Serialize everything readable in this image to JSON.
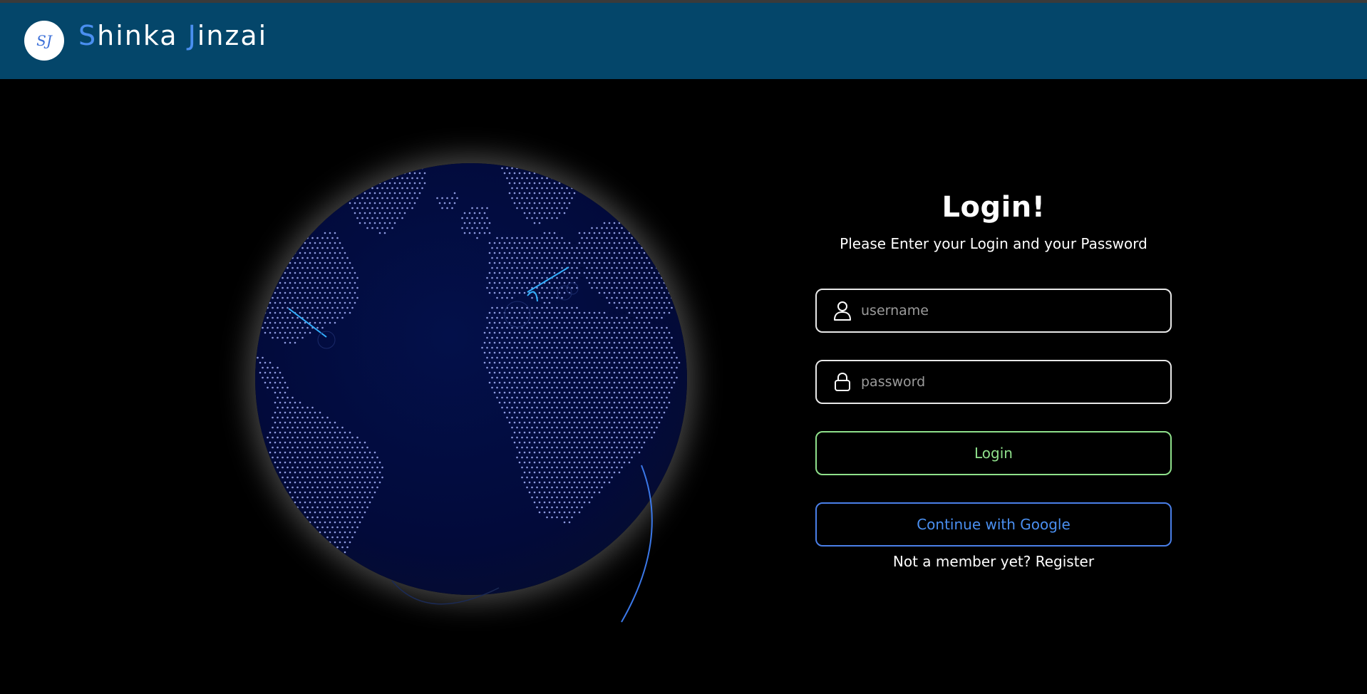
{
  "header": {
    "brand_first_initial": "S",
    "brand_first_rest": "hinka ",
    "brand_second_initial": "J",
    "brand_second_rest": "inzai",
    "logo_text": "SJ",
    "accent_color": "#4a8ff0",
    "background_color": "#04466a"
  },
  "login": {
    "title": "Login!",
    "subtitle": "Please Enter your Login and your Password",
    "username": {
      "icon": "user-icon",
      "value": "",
      "placeholder": "username"
    },
    "password": {
      "icon": "lock-icon",
      "value": "",
      "placeholder": "password"
    },
    "login_button": "Login",
    "google_button": "Continue with Google",
    "register_prompt": "Not a member yet?",
    "register_link": "Register",
    "login_button_color": "#8fe08b",
    "google_button_color": "#4a7fe8"
  },
  "globe": {
    "icon": "world-globe",
    "ocean_color": "#020a3d",
    "land_dot_color": "#a9b6ff"
  }
}
